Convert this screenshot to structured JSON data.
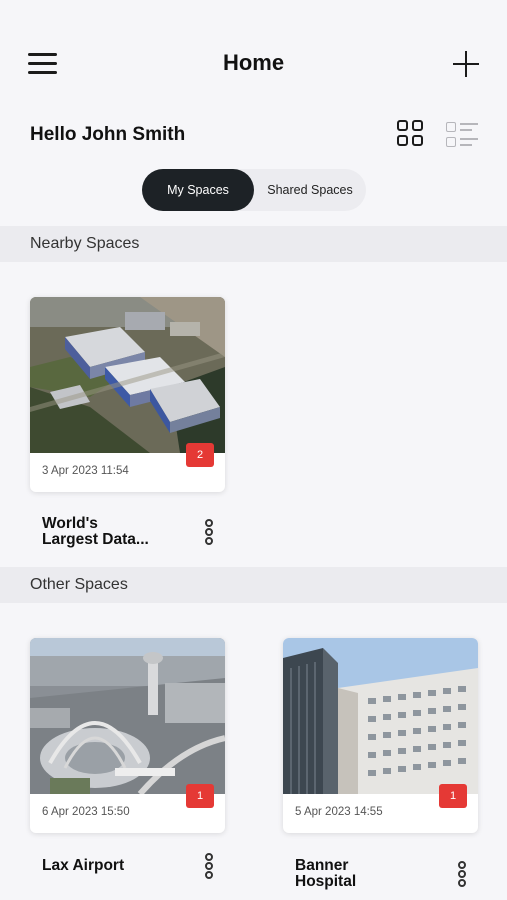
{
  "header": {
    "title": "Home",
    "menu_icon": "hamburger-menu-icon",
    "add_icon": "plus-icon"
  },
  "greeting": "Hello John Smith",
  "view_toggle": {
    "grid_icon": "grid-view-icon",
    "list_icon": "list-view-icon",
    "selected": "grid"
  },
  "segments": {
    "my_spaces": "My Spaces",
    "shared_spaces": "Shared Spaces",
    "selected": "My Spaces"
  },
  "nearby": {
    "title": "Nearby Spaces",
    "cards": [
      {
        "name": "World's Largest Data...",
        "name_line1": "World's",
        "name_line2": "Largest Data...",
        "date": "3 Apr 2023 11:54",
        "badge": "2",
        "image": "aerial data center"
      }
    ]
  },
  "other": {
    "title": "Other Spaces",
    "cards": [
      {
        "name_line1": "Lax Airport",
        "name_line2": "",
        "date": "6 Apr 2023 15:50",
        "badge": "1",
        "image": "airport aerial"
      },
      {
        "name_line1": "Banner",
        "name_line2": "Hospital",
        "date": "5 Apr 2023 14:55",
        "badge": "1",
        "image": "hospital building"
      }
    ]
  },
  "colors": {
    "accent_dark": "#1d2226",
    "badge_red": "#e53935",
    "background": "#f6f6f9",
    "section_bg": "#ebebef"
  }
}
